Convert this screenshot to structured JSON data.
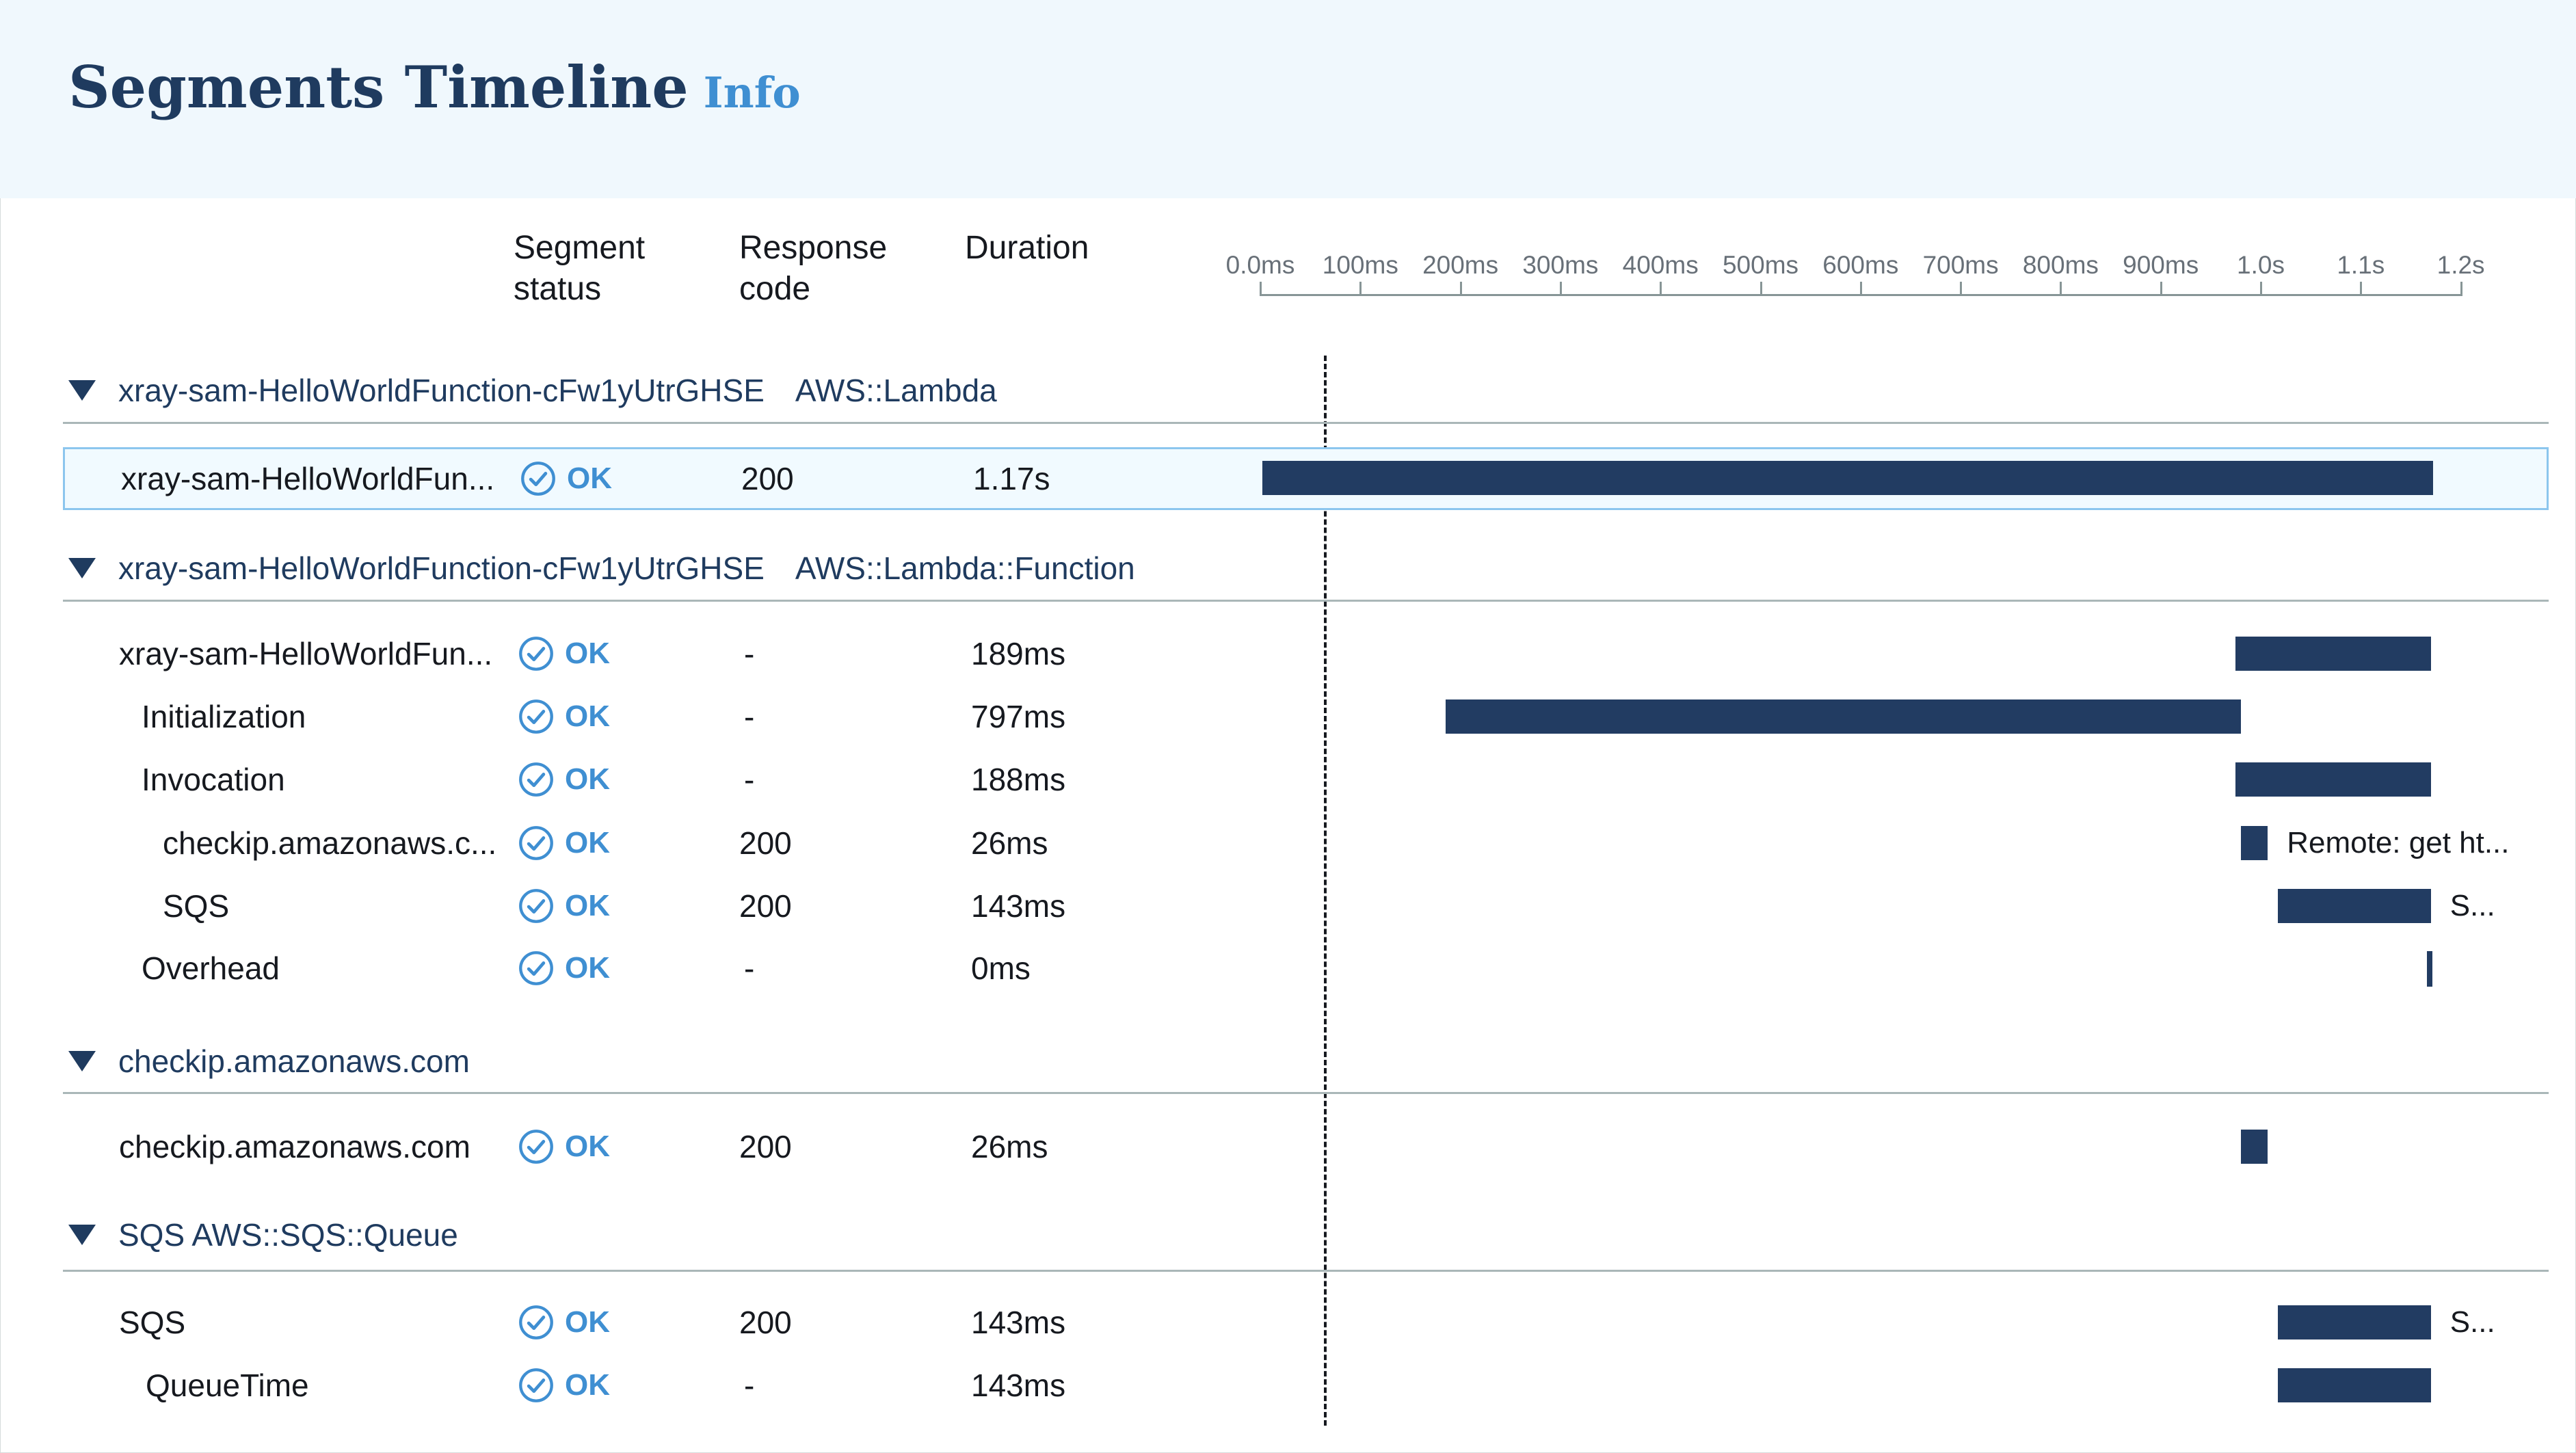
{
  "header": {
    "title": "Segments Timeline",
    "info_label": "Info"
  },
  "columns": {
    "status": "Segment\nstatus",
    "response": "Response\ncode",
    "duration": "Duration"
  },
  "timeline_ticks": [
    "0.0ms",
    "100ms",
    "200ms",
    "300ms",
    "400ms",
    "500ms",
    "600ms",
    "700ms",
    "800ms",
    "900ms",
    "1.0s",
    "1.1s",
    "1.2s"
  ],
  "groups": [
    {
      "name": "xray-sam-HelloWorldFunction-cFw1yUtrGHSE",
      "type": "AWS::Lambda"
    },
    {
      "name": "xray-sam-HelloWorldFunction-cFw1yUtrGHSE",
      "type": "AWS::Lambda::Function"
    },
    {
      "name": "checkip.amazonaws.com",
      "type": ""
    },
    {
      "name": "SQS AWS::SQS::Queue",
      "type": ""
    }
  ],
  "rows": [
    {
      "name": "xray-sam-HelloWorldFunction-cFw1yUtrGHSE",
      "display": "xray-sam-HelloWorldFun...",
      "status": "OK",
      "code": "200",
      "duration": "1.17s",
      "start_s": 0.0,
      "end_s": 1.17,
      "label": ""
    },
    {
      "name": "xray-sam-HelloWorldFunction-cFw1yUtrGHSE",
      "display": "xray-sam-HelloWorldFun...",
      "status": "OK",
      "code": "-",
      "duration": "189ms",
      "start_s": 0.975,
      "end_s": 1.17,
      "label": ""
    },
    {
      "name": "Initialization",
      "display": "Initialization",
      "status": "OK",
      "code": "-",
      "duration": "797ms",
      "start_s": 0.185,
      "end_s": 0.98,
      "label": ""
    },
    {
      "name": "Invocation",
      "display": "Invocation",
      "status": "OK",
      "code": "-",
      "duration": "188ms",
      "start_s": 0.975,
      "end_s": 1.17,
      "label": ""
    },
    {
      "name": "checkip.amazonaws.com",
      "display": "checkip.amazonaws.c...",
      "status": "OK",
      "code": "200",
      "duration": "26ms",
      "start_s": 0.98,
      "end_s": 1.007,
      "label": "Remote: get ht..."
    },
    {
      "name": "SQS",
      "display": "SQS",
      "status": "OK",
      "code": "200",
      "duration": "143ms",
      "start_s": 1.017,
      "end_s": 1.17,
      "label": "S..."
    },
    {
      "name": "Overhead",
      "display": "Overhead",
      "status": "OK",
      "code": "-",
      "duration": "0ms",
      "start_s": 1.166,
      "end_s": 1.17,
      "label": ""
    },
    {
      "name": "checkip.amazonaws.com",
      "display": "checkip.amazonaws.com",
      "status": "OK",
      "code": "200",
      "duration": "26ms",
      "start_s": 0.98,
      "end_s": 1.007,
      "label": ""
    },
    {
      "name": "SQS",
      "display": "SQS",
      "status": "OK",
      "code": "200",
      "duration": "143ms",
      "start_s": 1.017,
      "end_s": 1.17,
      "label": "S..."
    },
    {
      "name": "QueueTime",
      "display": "QueueTime",
      "status": "OK",
      "code": "-",
      "duration": "143ms",
      "start_s": 1.017,
      "end_s": 1.17,
      "label": ""
    }
  ],
  "colors": {
    "bar": "#223c62",
    "link": "#3f8fd2",
    "header_bg": "#f0f8fd",
    "title": "#1f3b5f"
  },
  "icons": {
    "caret": "caret-down-icon",
    "status": "check-circle-icon"
  }
}
